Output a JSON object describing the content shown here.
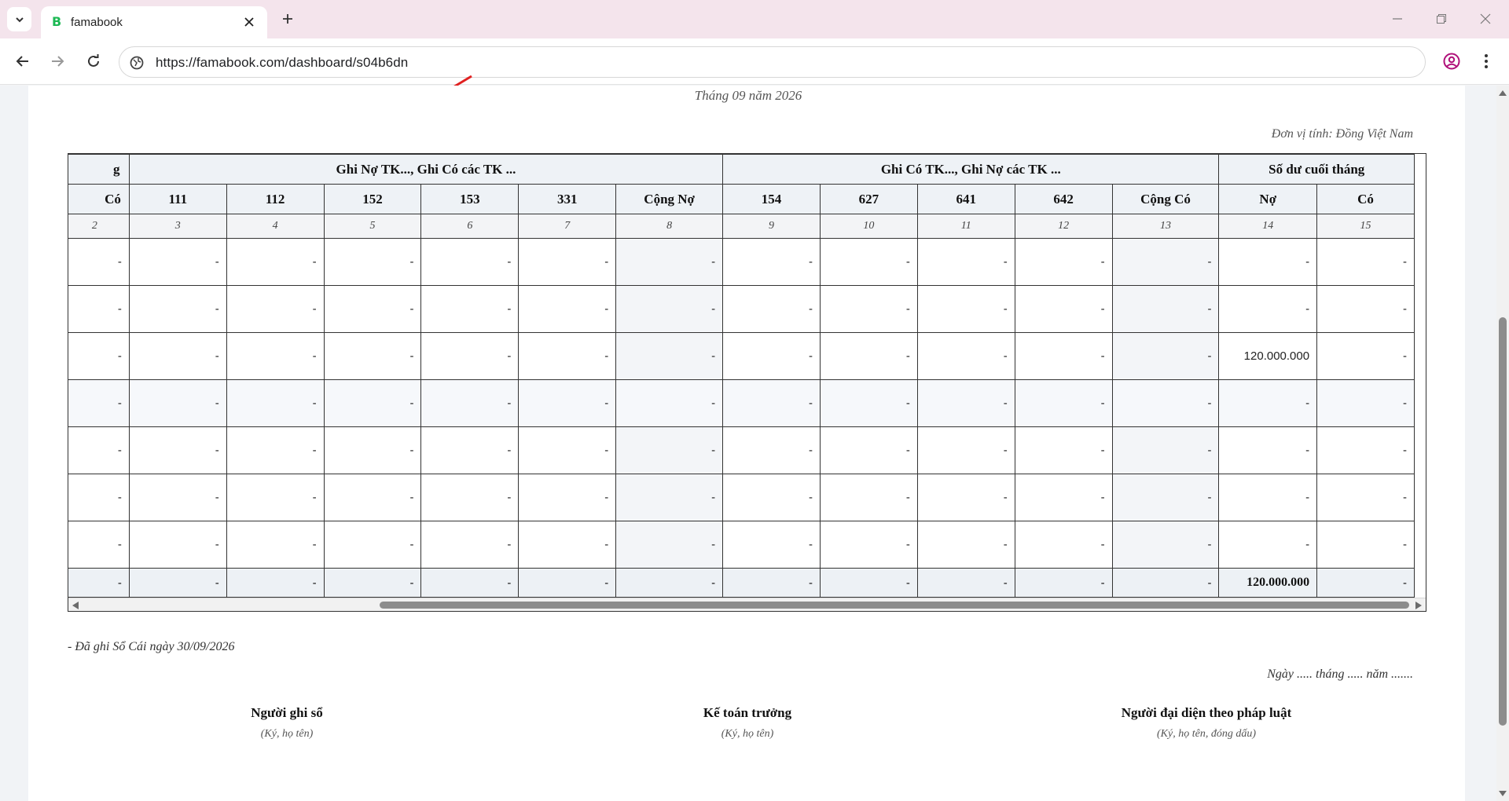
{
  "browser": {
    "tab_title": "famabook",
    "favicon_letter": "B",
    "url": "https://famabook.com/dashboard/s04b6dn",
    "accent": "#1db954",
    "annotation_color": "#e02020"
  },
  "report": {
    "period": "Tháng 09 năm 2026",
    "unit": "Đơn vị tính: Đồng Việt Nam",
    "header_groups": {
      "partial": "g",
      "debit_group": "Ghi Nợ TK..., Ghi Có các TK ...",
      "credit_group": "Ghi Có TK..., Ghi Nợ các TK ...",
      "end_balance": "Số dư cuối tháng"
    },
    "columns": [
      "Có",
      "111",
      "112",
      "152",
      "153",
      "331",
      "Cộng Nợ",
      "154",
      "627",
      "641",
      "642",
      "Cộng Có",
      "Nợ",
      "Có"
    ],
    "col_numbers": [
      "2",
      "3",
      "4",
      "5",
      "6",
      "7",
      "8",
      "9",
      "10",
      "11",
      "12",
      "13",
      "14",
      "15"
    ],
    "rows": [
      [
        "-",
        "-",
        "-",
        "-",
        "-",
        "-",
        "-",
        "-",
        "-",
        "-",
        "-",
        "-",
        "-",
        "-"
      ],
      [
        "-",
        "-",
        "-",
        "-",
        "-",
        "-",
        "-",
        "-",
        "-",
        "-",
        "-",
        "-",
        "-",
        "-"
      ],
      [
        "-",
        "-",
        "-",
        "-",
        "-",
        "-",
        "-",
        "-",
        "-",
        "-",
        "-",
        "-",
        "120.000.000",
        "-"
      ],
      [
        "-",
        "-",
        "-",
        "-",
        "-",
        "-",
        "-",
        "-",
        "-",
        "-",
        "-",
        "-",
        "-",
        "-"
      ],
      [
        "-",
        "-",
        "-",
        "-",
        "-",
        "-",
        "-",
        "-",
        "-",
        "-",
        "-",
        "-",
        "-",
        "-"
      ],
      [
        "-",
        "-",
        "-",
        "-",
        "-",
        "-",
        "-",
        "-",
        "-",
        "-",
        "-",
        "-",
        "-",
        "-"
      ],
      [
        "-",
        "-",
        "-",
        "-",
        "-",
        "-",
        "-",
        "-",
        "-",
        "-",
        "-",
        "-",
        "-",
        "-"
      ]
    ],
    "total": [
      "-",
      "-",
      "-",
      "-",
      "-",
      "-",
      "-",
      "-",
      "-",
      "-",
      "-",
      "-",
      "120.000.000",
      "-"
    ],
    "posted_note": "- Đã ghi Sổ Cái ngày 30/09/2026",
    "date_line": "Ngày ..... tháng ..... năm .......",
    "signatures": [
      {
        "title": "Người ghi sổ",
        "sub": "(Ký, họ tên)"
      },
      {
        "title": "Kế toán trưởng",
        "sub": "(Ký, họ tên)"
      },
      {
        "title": "Người đại diện theo pháp luật",
        "sub": "(Ký, họ tên, đóng dấu)"
      }
    ]
  }
}
